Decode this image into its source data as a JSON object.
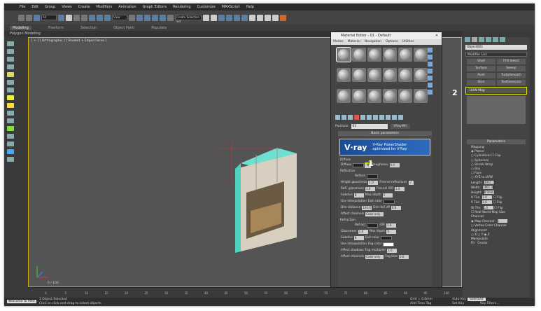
{
  "menu": [
    "File",
    "Edit",
    "Group",
    "Views",
    "Create",
    "Modifiers",
    "Animation",
    "Graph Editors",
    "Rendering",
    "Customize",
    "MAXScript",
    "Help"
  ],
  "toolbar": {
    "selection_set": "All",
    "view": "View",
    "named_set": "Create Selection Set"
  },
  "ribbon": {
    "tabs": [
      "Modeling",
      "Freeform",
      "Selection",
      "Object Paint",
      "Populate"
    ],
    "active": "Modeling",
    "sub": "Polygon Modeling"
  },
  "viewport": {
    "label": "[ + ] [ Orthographic ] [ Shaded + Edged Faces ]"
  },
  "material_editor": {
    "title": "Material Editor - 01 - Default",
    "menus": [
      "Modes",
      "Material",
      "Navigation",
      "Options",
      "Utilities"
    ],
    "name_label": "Portfolio",
    "mat_name": "01",
    "mat_type": "VRayMtl",
    "rollout": "Basic parameters",
    "vray": {
      "logo": "V·ray",
      "line1": "V-Ray PowerShader",
      "line2": "optimized for V-Ray"
    },
    "diffuse": {
      "section": "Diffuse",
      "label": "Diffuse",
      "map_btn": "M",
      "roughness_label": "Roughness",
      "roughness": "0.0"
    },
    "reflection": {
      "section": "Reflection",
      "reflect": "Reflect",
      "hilight": "Hilight glossiness",
      "hilight_val": "1.0",
      "fresnel": "Fresnel reflections",
      "refl_gloss": "Refl. glossiness",
      "refl_gloss_val": "1.0",
      "fresnel_ior": "Fresnel IOR",
      "fresnel_ior_val": "1.6",
      "subdivs": "Subdivs",
      "subdivs_val": "8",
      "max_depth": "Max depth",
      "max_depth_val": "5",
      "use_interp": "Use interpolation",
      "exit_color": "Exit color",
      "dim_distance": "Dim distance",
      "dim_val": "100.0",
      "dim_falloff": "Dim fall off",
      "dim_falloff_val": "0.0",
      "affect": "Affect channels",
      "affect_val": "Color only"
    },
    "refraction": {
      "section": "Refraction",
      "refract": "Refract",
      "ior": "IOR",
      "ior_val": "1.6",
      "glossiness": "Glossiness",
      "gloss_val": "1.0",
      "max_depth": "Max depth",
      "max_depth_val": "5",
      "subdivs": "Subdivs",
      "subdivs_val": "8",
      "exit_color": "Exit color",
      "use_interp": "Use interpolation",
      "fog_color": "Fog color",
      "affect_shadows": "Affect shadows",
      "fog_mult": "Fog multiplier",
      "fog_mult_val": "1.0",
      "affect": "Affect channels",
      "affect_val": "Color only",
      "fog_bias": "Fog bias",
      "fog_bias_val": "0.0"
    }
  },
  "command_panel": {
    "object_name": "Object001",
    "modifier_list": "Modifier List",
    "buttons": [
      "Shell",
      "FFD Select",
      "Surface",
      "Sweep",
      "Push",
      "TurboSmooth",
      "Slice",
      "TextGenerate"
    ],
    "stack_item": "UVW Map",
    "params_title": "Parameters",
    "mapping_label": "Mapping:",
    "mapping": [
      "Planar",
      "Cylindrical",
      "Cap",
      "Spherical",
      "Shrink Wrap",
      "Box",
      "Face",
      "XYZ to UVW"
    ],
    "length": "Length:",
    "length_val": "1861.2H",
    "width": "Width:",
    "width_val": "1861.3H",
    "height": "Height:",
    "height_val": "0.0mm",
    "utile": "U Tile:",
    "vtile": "V Tile:",
    "wtile": "W Tile:",
    "tile_val": "1.0",
    "flip": "Flip",
    "real_world": "Real-World Map Size",
    "channel_label": "Channel:",
    "map_channel": "Map Channel:",
    "map_channel_val": "1",
    "vertex_color": "Vertex Color Channel",
    "alignment": "Alignment:",
    "axes": [
      "X",
      "Y",
      "Z"
    ],
    "manipulate": "Manipulate",
    "fit": "Fit",
    "center": "Center"
  },
  "badges": {
    "one": "1",
    "two": "2"
  },
  "timeline": {
    "frame": "0 / 100",
    "ticks": [
      "0",
      "5",
      "10",
      "15",
      "20",
      "25",
      "30",
      "35",
      "40",
      "45",
      "50",
      "55",
      "60",
      "65",
      "70",
      "75",
      "80",
      "85",
      "90",
      "95",
      "100"
    ]
  },
  "status": {
    "welcome": "Welcome to MAX",
    "selected": "1 Object Selected",
    "hint": "Click or click-and-drag to select objects",
    "grid": "Grid = 0.0mm",
    "autokey": "Auto Key",
    "selected_label": "Selected",
    "setkey": "Set Key",
    "key_filters": "Key Filters...",
    "add_time_tag": "Add Time Tag"
  }
}
